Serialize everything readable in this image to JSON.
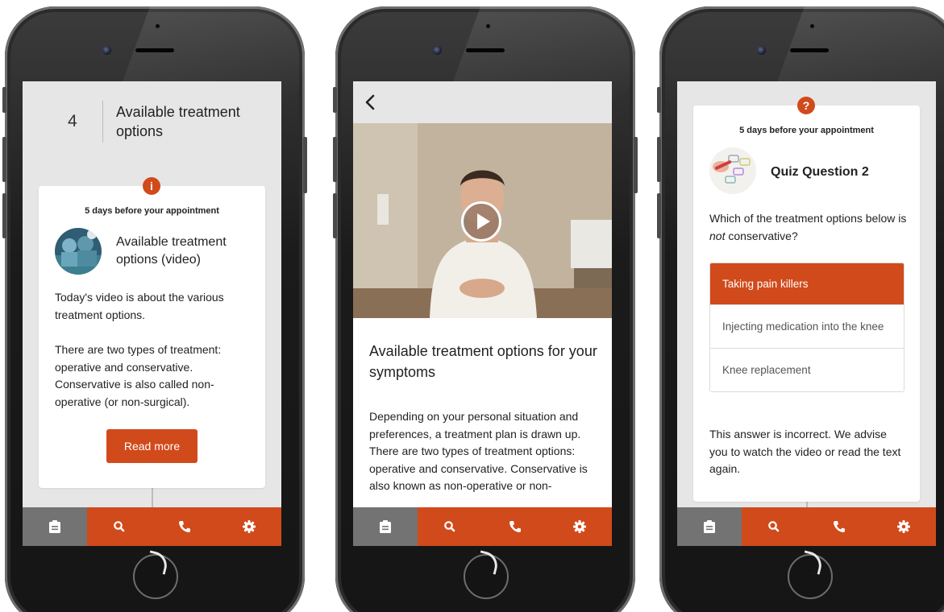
{
  "accent_color": "#d14a1b",
  "nav": [
    {
      "icon": "clipboard-icon",
      "active": true
    },
    {
      "icon": "search-icon",
      "active": false
    },
    {
      "icon": "phone-icon",
      "active": false
    },
    {
      "icon": "gear-icon",
      "active": false
    }
  ],
  "phone1": {
    "step_number": "4",
    "step_title": "Available treatment options",
    "card": {
      "badge_icon": "info-icon",
      "badge_text": "i",
      "date": "5 days before your appointment",
      "heading": "Available treatment options (video)",
      "paragraph1": "Today's video is about the various treatment options.",
      "paragraph2": "There are two types of treatment: operative and conservative. Conservative is also called non-operative (or non-surgical).",
      "button": "Read more"
    }
  },
  "phone2": {
    "back_icon": "chevron-left-icon",
    "play_icon": "play-icon",
    "title": "Available treatment options for your symptoms",
    "body": "Depending on your personal situation and preferences, a treatment plan is drawn up. There are two types of treatment options: operative and conservative. Conservative is also known as non-operative or non-"
  },
  "phone3": {
    "badge_icon": "question-icon",
    "badge_text": "?",
    "date": "5 days before your appointment",
    "heading": "Quiz Question 2",
    "question_pre": "Which of the treatment options below is ",
    "question_em": "not",
    "question_post": " conservative?",
    "options": [
      {
        "label": "Taking pain killers",
        "selected": true
      },
      {
        "label": "Injecting medication into the knee",
        "selected": false
      },
      {
        "label": "Knee replacement",
        "selected": false
      }
    ],
    "feedback": "This answer is incorrect. We advise you to watch the video or read the text again."
  }
}
